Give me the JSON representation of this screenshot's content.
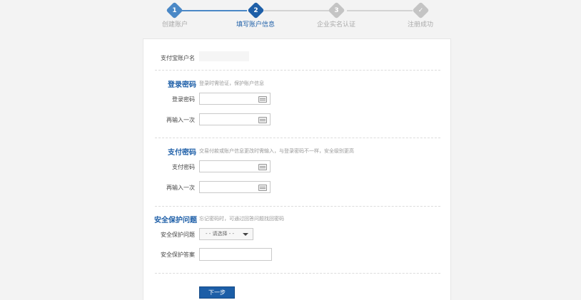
{
  "colors": {
    "active": "#4a88c6",
    "current": "#1e5fa8",
    "inactive": "#c4c4c4",
    "title": "#1e5fa8"
  },
  "stepper": {
    "steps": [
      {
        "num": "1",
        "label": "创建账户",
        "state": "done"
      },
      {
        "num": "2",
        "label": "填写账户信息",
        "state": "current"
      },
      {
        "num": "3",
        "label": "企业实名认证",
        "state": "todo"
      },
      {
        "num": "✓",
        "label": "注册成功",
        "state": "todo"
      }
    ]
  },
  "form": {
    "account": {
      "label": "支付宝账户名",
      "value": ""
    },
    "login_password": {
      "title": "登录密码",
      "hint": "登录时需验证，保护账户信息",
      "password_label": "登录密码",
      "confirm_label": "再输入一次",
      "keyboard_icon": "keyboard-icon"
    },
    "pay_password": {
      "title": "支付密码",
      "hint": "交易付款或账户信息更改时需输入，与登录密码不一样，安全级别更高",
      "password_label": "支付密码",
      "confirm_label": "再输入一次",
      "keyboard_icon": "keyboard-icon"
    },
    "security_question": {
      "title": "安全保护问题",
      "hint": "忘记密码时，可通过回答问题找回密码",
      "question_label": "安全保护问题",
      "question_selected": "- - 请选择 - -",
      "answer_label": "安全保护答案",
      "answer_value": ""
    },
    "next_button": "下一步"
  }
}
